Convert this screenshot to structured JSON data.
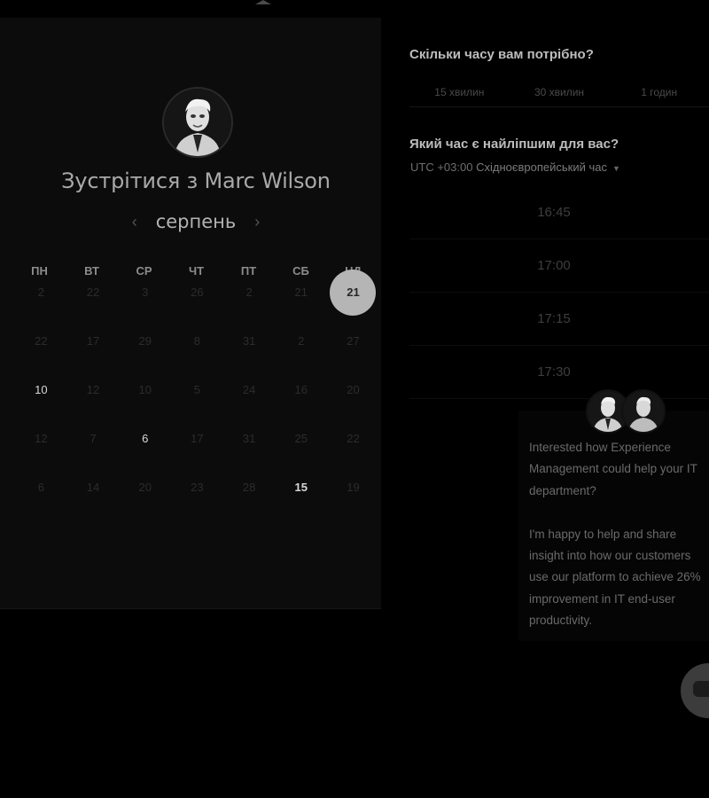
{
  "meeting": {
    "title_prefix": "Зустрітися з ",
    "host_name": "Marc Wilson"
  },
  "calendar": {
    "month": "серпень",
    "prev_icon": "‹",
    "next_icon": "›",
    "weekdays": [
      "ПН",
      "ВТ",
      "СР",
      "ЧТ",
      "ПТ",
      "СБ",
      "НД"
    ],
    "selected_day": "21",
    "rows": [
      [
        "2",
        "22",
        "3",
        "26",
        "2",
        "21",
        "21"
      ],
      [
        "22",
        "17",
        "29",
        "8",
        "31",
        "2",
        "27"
      ],
      [
        "10",
        "12",
        "10",
        "5",
        "24",
        "16",
        "20"
      ],
      [
        "12",
        "7",
        "6",
        "17",
        "31",
        "25",
        "22"
      ],
      [
        "6",
        "14",
        "20",
        "23",
        "28",
        "15",
        "19"
      ]
    ]
  },
  "duration": {
    "question": "Скільки часу вам потрібно?",
    "options": [
      "15 хвилин",
      "30 хвилин",
      "1 годин"
    ]
  },
  "time": {
    "question": "Який час є найліпшим для вас?",
    "timezone_offset": "UTC +03:00 ",
    "timezone_name": "Східноєвропейський час",
    "slots": [
      "16:45",
      "17:00",
      "17:15",
      "17:30"
    ]
  },
  "chat": {
    "lines_1": [
      "Interested how Experience",
      "Management could help your IT",
      "department?"
    ],
    "lines_2": [
      "I'm happy to help and share",
      "insight into how our customers",
      "use our platform to achieve 26%",
      "improvement in IT end-user",
      "productivity."
    ]
  },
  "colors": {
    "background": "#000000",
    "card": "#0c0c0c",
    "selected_day": "#b5b5b5"
  },
  "icons": {
    "prev": "chevron-left-icon",
    "next": "chevron-right-icon",
    "timezone": "caret-down-icon",
    "chat": "chat-bubble-icon"
  }
}
